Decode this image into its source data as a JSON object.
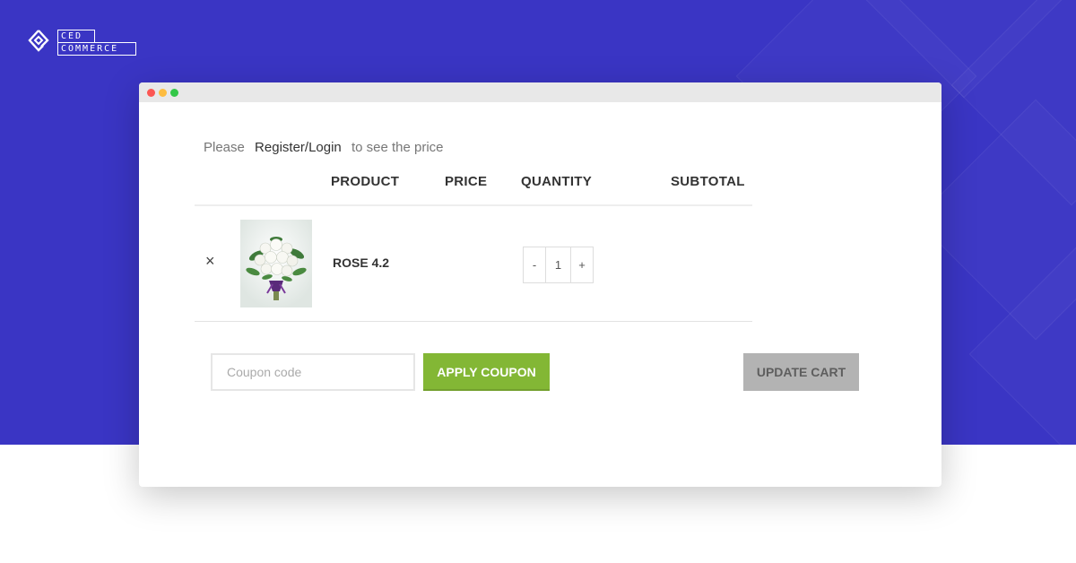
{
  "brand": {
    "line1": "CED",
    "line2": "COMMERCE"
  },
  "colors": {
    "background": "#3a35c4",
    "apply_button": "#83b735",
    "update_button": "#b3b3b3"
  },
  "window": {
    "controls": [
      "close",
      "minimize",
      "maximize"
    ]
  },
  "notice": {
    "prefix": "Please",
    "link": "Register/Login",
    "suffix": "to see the price"
  },
  "table": {
    "headers": {
      "product": "PRODUCT",
      "price": "PRICE",
      "quantity": "QUANTITY",
      "subtotal": "SUBTOTAL"
    },
    "rows": [
      {
        "remove_icon": "×",
        "image_icon": "rose-bouquet-image",
        "name": "ROSE 4.2",
        "qty_minus": "-",
        "qty": "1",
        "qty_plus": "+"
      }
    ]
  },
  "coupon": {
    "placeholder": "Coupon code",
    "value": "",
    "apply_label": "APPLY COUPON"
  },
  "update_label": "UPDATE CART"
}
